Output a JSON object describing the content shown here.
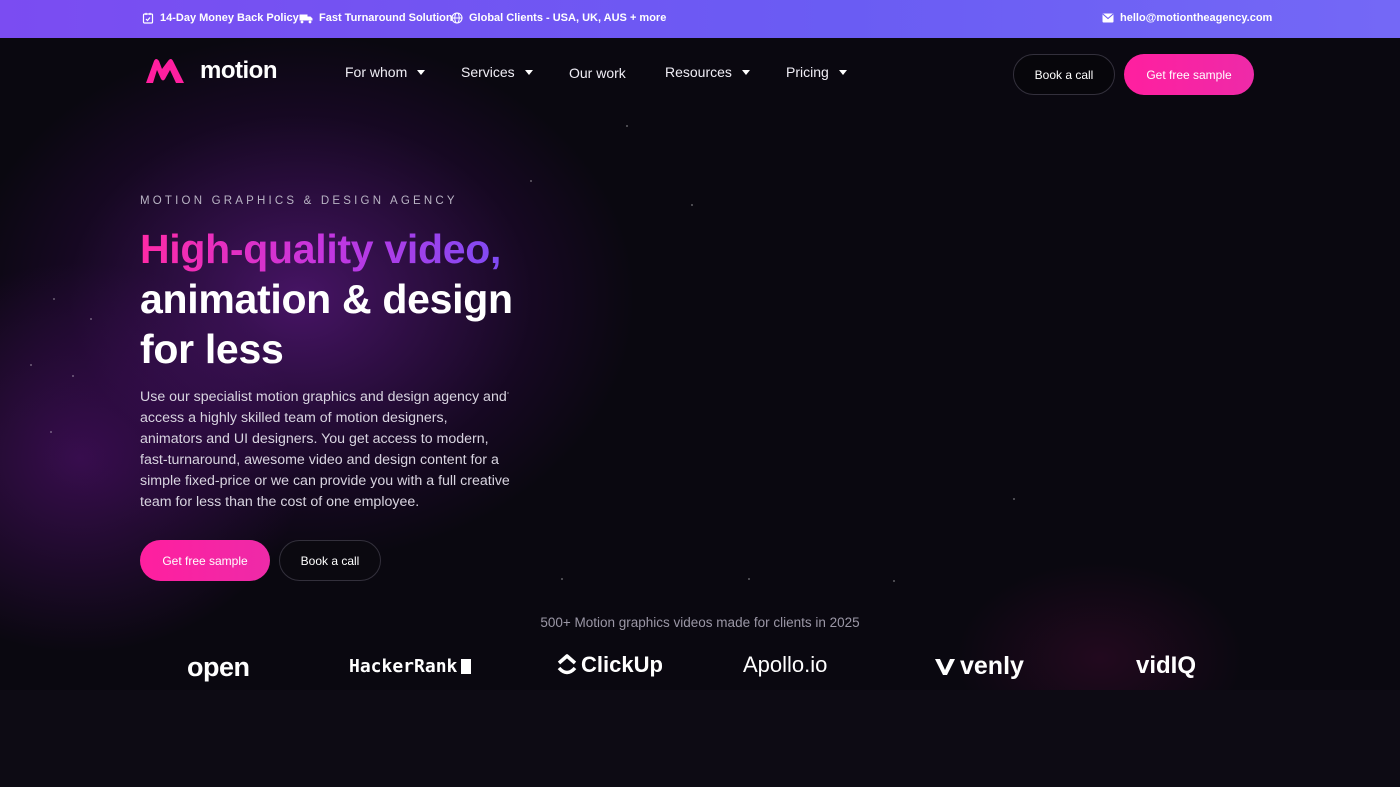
{
  "topbar": {
    "items": [
      {
        "icon": "calendar-check-icon",
        "label": "14-Day Money Back Policy"
      },
      {
        "icon": "truck-icon",
        "label": "Fast Turnaround Solution"
      },
      {
        "icon": "globe-icon",
        "label": "Global Clients - USA, UK, AUS + more"
      }
    ],
    "email": {
      "icon": "mail-icon",
      "label": "hello@motiontheagency.com"
    }
  },
  "brand": {
    "name": "motion",
    "accent": "#ff1f9f"
  },
  "nav": {
    "items": [
      {
        "label": "For whom",
        "dropdown": true
      },
      {
        "label": "Services",
        "dropdown": true
      },
      {
        "label": "Our work",
        "dropdown": false
      },
      {
        "label": "Resources",
        "dropdown": true
      },
      {
        "label": "Pricing",
        "dropdown": true
      }
    ],
    "book_call": "Book a call",
    "get_sample": "Get free sample"
  },
  "hero": {
    "eyebrow": "MOTION GRAPHICS & DESIGN AGENCY",
    "title_line1": "High-quality video,",
    "title_line2": "animation & design",
    "title_line3": "for less",
    "lead": "Use our specialist motion graphics and design agency and access a highly skilled team of motion designers, animators and UI designers. You get access to modern, fast-turnaround, awesome video and design content for a simple fixed-price or we can provide you with a full creative team for less than the cost of one employee.",
    "cta_primary": "Get free sample",
    "cta_secondary": "Book a call"
  },
  "clients": {
    "caption": "500+ Motion graphics videos made for clients in 2025",
    "logos": [
      "open",
      "HackerRank",
      "ClickUp",
      "Apollo.io",
      "venly",
      "vidIQ"
    ]
  }
}
